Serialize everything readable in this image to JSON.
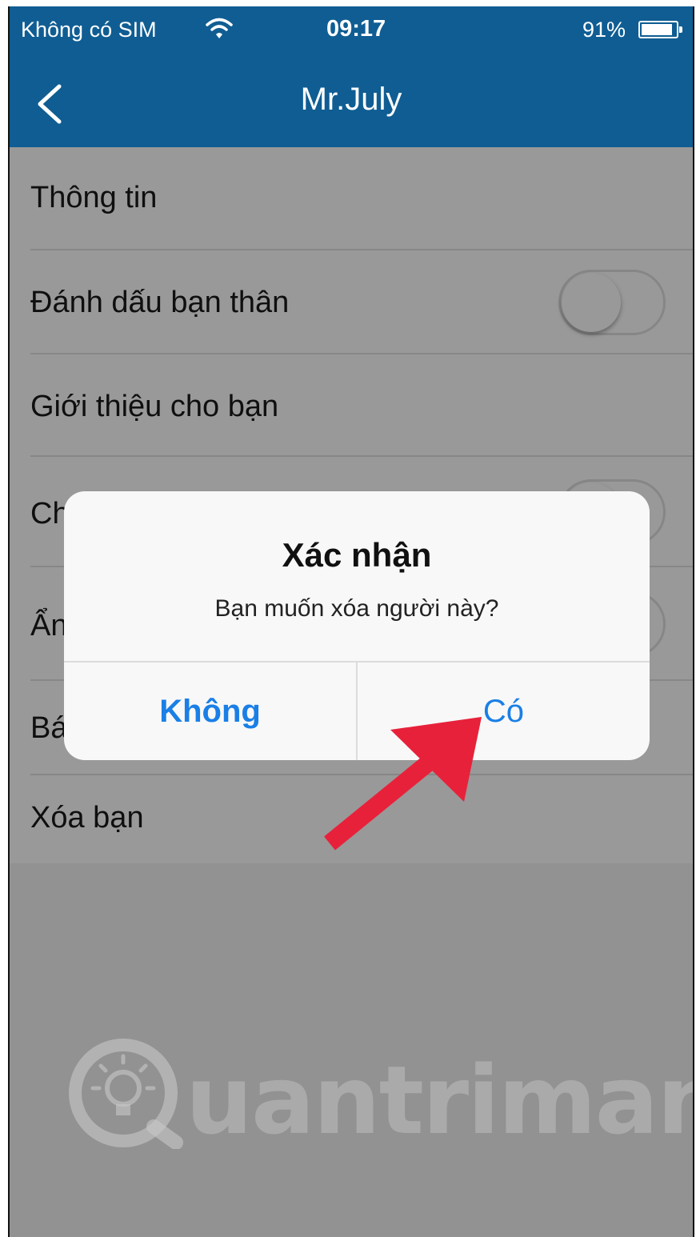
{
  "status_bar": {
    "carrier": "Không có SIM",
    "time": "09:17",
    "battery": "91%",
    "battery_level": 0.91,
    "wifi_icon": "wifi-icon"
  },
  "nav": {
    "back_icon": "chevron-left-icon",
    "title": "Mr.July"
  },
  "menu": {
    "items": [
      {
        "label": "Thông tin",
        "toggle": false
      },
      {
        "label": "Đánh dấu bạn thân",
        "toggle": true,
        "on": false
      },
      {
        "label": "Giới thiệu cho bạn",
        "toggle": false
      },
      {
        "label": "Ch",
        "toggle": true,
        "on": false
      },
      {
        "label": "Ẩn",
        "toggle": true,
        "on": false
      },
      {
        "label": "Bá",
        "toggle": false
      },
      {
        "label": "Xóa bạn",
        "toggle": false
      }
    ]
  },
  "dialog": {
    "title": "Xác nhận",
    "message": "Bạn muốn xóa người này?",
    "cancel_label": "Không",
    "confirm_label": "Có"
  },
  "annotation": {
    "arrow_icon": "red-arrow-icon"
  },
  "watermark": {
    "text": "uantrimang",
    "logo_icon": "lightbulb-logo-icon"
  },
  "colors": {
    "header": "#0f5d93",
    "dialog_button": "#1a7fe6",
    "arrow": "#e8213a"
  }
}
